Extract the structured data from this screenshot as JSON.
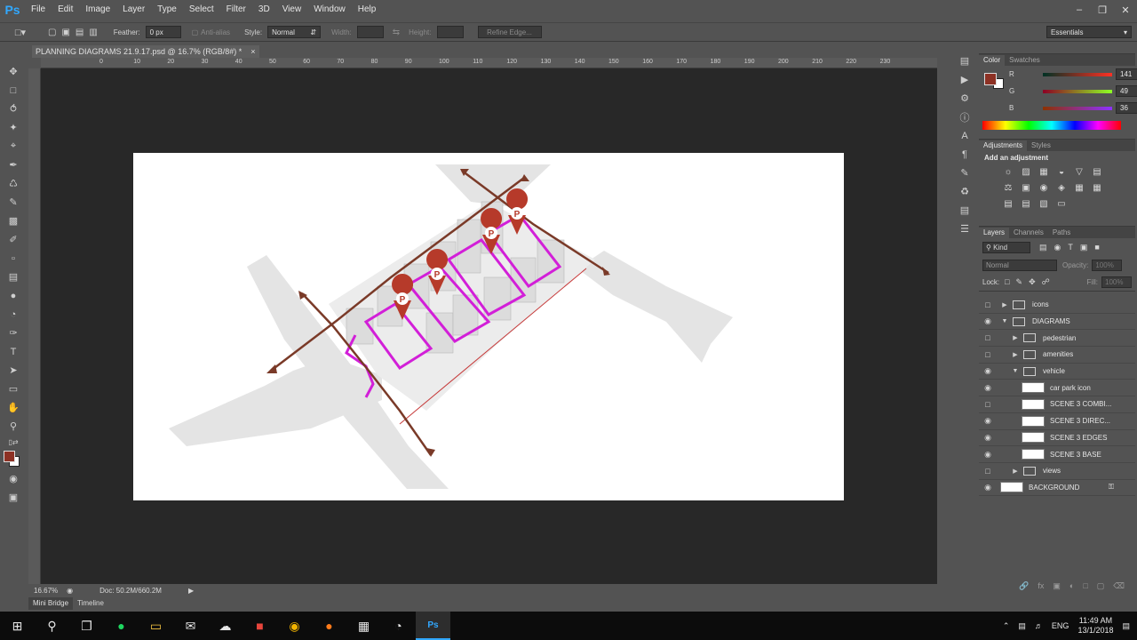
{
  "app": {
    "logo": "Ps"
  },
  "menu": [
    "File",
    "Edit",
    "Image",
    "Layer",
    "Type",
    "Select",
    "Filter",
    "3D",
    "View",
    "Window",
    "Help"
  ],
  "options": {
    "feather_label": "Feather:",
    "feather_value": "0 px",
    "antialias_label": "Anti-alias",
    "style_label": "Style:",
    "style_value": "Normal",
    "width_label": "Width:",
    "height_label": "Height:",
    "refine_edge": "Refine Edge...",
    "workspace": "Essentials"
  },
  "document": {
    "tab_title": "PLANNING DIAGRAMS 21.9.17.psd @ 16.7% (RGB/8#) *",
    "close": "×"
  },
  "ruler_top": [
    "0",
    "10",
    "20",
    "30",
    "40",
    "50",
    "60",
    "70",
    "80",
    "90",
    "100",
    "110",
    "120",
    "130",
    "140",
    "150",
    "160",
    "170",
    "180",
    "190",
    "200",
    "210",
    "220",
    "230"
  ],
  "status": {
    "zoom": "16.67%",
    "doc": "Doc: 50.2M/660.2M"
  },
  "bottom_tabs": [
    "Mini Bridge",
    "Timeline"
  ],
  "color_panel": {
    "tabs": [
      "Color",
      "Swatches"
    ],
    "foreground": "#8d3124",
    "r_label": "R",
    "r": "141",
    "g_label": "G",
    "g": "49",
    "b_label": "B",
    "b": "36"
  },
  "adjustments_panel": {
    "tabs": [
      "Adjustments",
      "Styles"
    ],
    "heading": "Add an adjustment"
  },
  "layers_panel": {
    "tabs": [
      "Layers",
      "Channels",
      "Paths"
    ],
    "kind": "Kind",
    "blend_mode": "Normal",
    "opacity_label": "Opacity:",
    "opacity": "100%",
    "lock_label": "Lock:",
    "fill_label": "Fill:",
    "fill": "100%",
    "layers": [
      {
        "name": "icons",
        "type": "group",
        "visible": false,
        "expanded": false,
        "indent": 0
      },
      {
        "name": "DIAGRAMS",
        "type": "group",
        "visible": true,
        "expanded": true,
        "indent": 0
      },
      {
        "name": "pedestrian",
        "type": "group",
        "visible": false,
        "expanded": false,
        "indent": 1
      },
      {
        "name": "amenities",
        "type": "group",
        "visible": false,
        "expanded": false,
        "indent": 1
      },
      {
        "name": "vehicle",
        "type": "group",
        "visible": true,
        "expanded": true,
        "indent": 1
      },
      {
        "name": "car park icon",
        "type": "layer",
        "visible": true,
        "indent": 2
      },
      {
        "name": "SCENE 3 COMBI...",
        "type": "layer",
        "visible": false,
        "indent": 2
      },
      {
        "name": "SCENE 3 DIREC...",
        "type": "layer",
        "visible": true,
        "indent": 2
      },
      {
        "name": "SCENE 3 EDGES",
        "type": "layer",
        "visible": true,
        "indent": 2
      },
      {
        "name": "SCENE 3 BASE",
        "type": "layer",
        "visible": true,
        "indent": 2
      },
      {
        "name": "views",
        "type": "group",
        "visible": false,
        "expanded": false,
        "indent": 1
      },
      {
        "name": "BACKGROUND",
        "type": "layer",
        "visible": true,
        "indent": 0,
        "locked": true
      }
    ]
  },
  "taskbar": {
    "lang": "ENG",
    "time": "11:49 AM",
    "date": "13/1/2018"
  },
  "diagram": {
    "marker_letter": "P",
    "marker_color": "#b63a2a",
    "route_color": "#7a3a28",
    "parking_color": "#d21fd8"
  }
}
